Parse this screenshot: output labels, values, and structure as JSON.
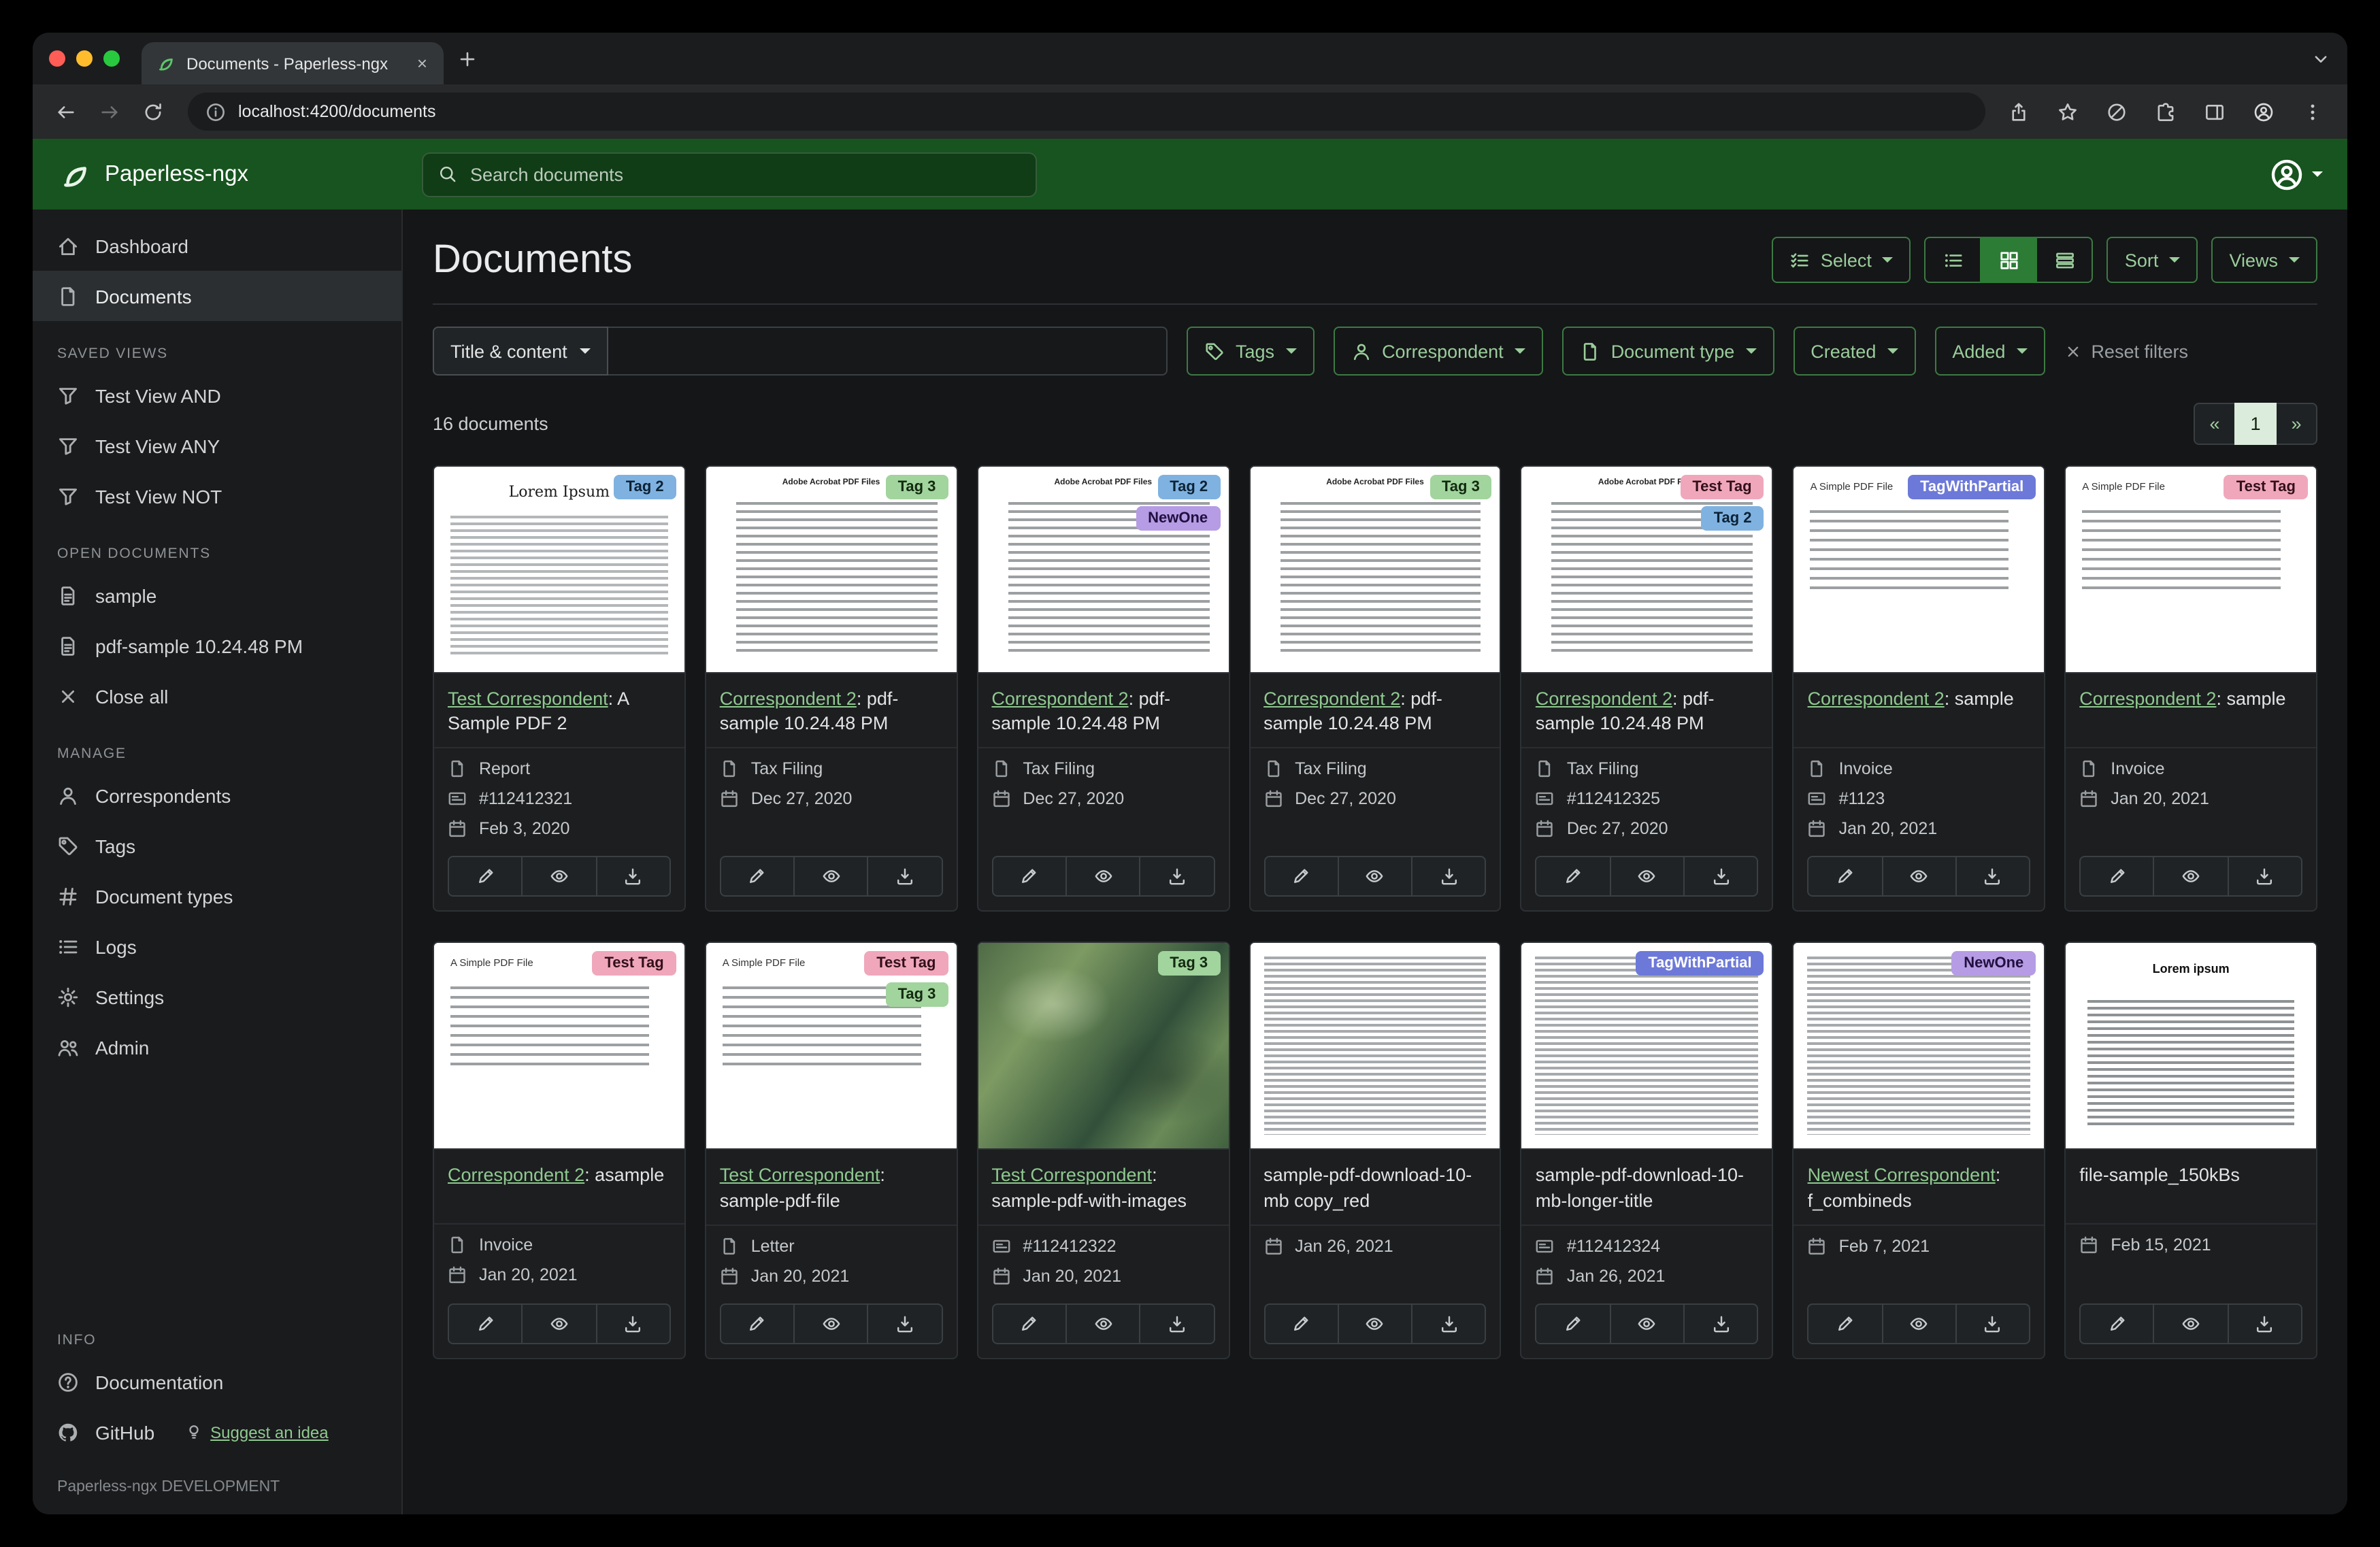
{
  "browser": {
    "tab_title": "Documents - Paperless-ngx",
    "url": "localhost:4200/documents"
  },
  "navbar": {
    "brand": "Paperless-ngx",
    "search_placeholder": "Search documents"
  },
  "sidebar": {
    "items": [
      {
        "label": "Dashboard",
        "icon": "house",
        "active": false
      },
      {
        "label": "Documents",
        "icon": "file",
        "active": true
      }
    ],
    "sections": [
      {
        "title": "SAVED VIEWS",
        "items": [
          {
            "label": "Test View AND",
            "icon": "funnel"
          },
          {
            "label": "Test View ANY",
            "icon": "funnel"
          },
          {
            "label": "Test View NOT",
            "icon": "funnel"
          }
        ]
      },
      {
        "title": "OPEN DOCUMENTS",
        "items": [
          {
            "label": "sample",
            "icon": "file-text"
          },
          {
            "label": "pdf-sample 10.24.48 PM",
            "icon": "file-text"
          },
          {
            "label": "Close all",
            "icon": "x"
          }
        ]
      },
      {
        "title": "MANAGE",
        "items": [
          {
            "label": "Correspondents",
            "icon": "person"
          },
          {
            "label": "Tags",
            "icon": "tag"
          },
          {
            "label": "Document types",
            "icon": "hash"
          },
          {
            "label": "Logs",
            "icon": "list"
          },
          {
            "label": "Settings",
            "icon": "gear"
          },
          {
            "label": "Admin",
            "icon": "people"
          }
        ]
      },
      {
        "title": "INFO",
        "items": [
          {
            "label": "Documentation",
            "icon": "question"
          },
          {
            "label": "GitHub",
            "icon": "github",
            "extra": {
              "label": "Suggest an idea",
              "icon": "bulb"
            }
          }
        ]
      }
    ],
    "footer": "Paperless-ngx DEVELOPMENT"
  },
  "main": {
    "title": "Documents",
    "toolbar": {
      "select_label": "Select",
      "sort_label": "Sort",
      "views_label": "Views",
      "view_modes": [
        {
          "icon": "list-ul",
          "active": false
        },
        {
          "icon": "grid",
          "active": true
        },
        {
          "icon": "hbars",
          "active": false
        }
      ]
    },
    "filters": {
      "field_label": "Title & content",
      "buttons": [
        {
          "label": "Tags",
          "icon": "tag"
        },
        {
          "label": "Correspondent",
          "icon": "person"
        },
        {
          "label": "Document type",
          "icon": "file"
        },
        {
          "label": "Created",
          "icon": null
        },
        {
          "label": "Added",
          "icon": null
        }
      ],
      "reset_label": "Reset filters"
    },
    "count": "16 documents",
    "pagination": [
      "«",
      "1",
      "»"
    ]
  },
  "tag_colors": {
    "Tag 2": {
      "bg": "#7fb2e0",
      "fg": "#0c2236"
    },
    "Tag 3": {
      "bg": "#a2d49d",
      "fg": "#122a10"
    },
    "NewOne": {
      "bg": "#b69ce4",
      "fg": "#221040"
    },
    "Test Tag": {
      "bg": "#f0a7bb",
      "fg": "#33101b"
    },
    "TagWithPartial": {
      "bg": "#6d79d8",
      "fg": "#ffffff"
    }
  },
  "documents": [
    {
      "thumb": "serif",
      "thumb_label": "Lorem Ipsum",
      "tags": [
        "Tag 2"
      ],
      "correspondent": "Test Correspondent",
      "title": ": A Sample PDF 2",
      "type": "Report",
      "asn": "#112412321",
      "date": "Feb 3, 2020"
    },
    {
      "thumb": "pdf",
      "thumb_label": "Adobe Acrobat PDF Files",
      "tags": [
        "Tag 3"
      ],
      "correspondent": "Correspondent 2",
      "title": ": pdf-sample 10.24.48 PM",
      "type": "Tax Filing",
      "date": "Dec 27, 2020"
    },
    {
      "thumb": "pdf",
      "thumb_label": "Adobe Acrobat PDF Files",
      "tags": [
        "Tag 2",
        "NewOne"
      ],
      "correspondent": "Correspondent 2",
      "title": ": pdf-sample 10.24.48 PM",
      "type": "Tax Filing",
      "date": "Dec 27, 2020"
    },
    {
      "thumb": "pdf",
      "thumb_label": "Adobe Acrobat PDF Files",
      "tags": [
        "Tag 3"
      ],
      "correspondent": "Correspondent 2",
      "title": ": pdf-sample 10.24.48 PM",
      "type": "Tax Filing",
      "date": "Dec 27, 2020"
    },
    {
      "thumb": "pdf",
      "thumb_label": "Adobe Acrobat PDF Files",
      "tags": [
        "Test Tag",
        "Tag 2"
      ],
      "correspondent": "Correspondent 2",
      "title": ": pdf-sample 10.24.48 PM",
      "type": "Tax Filing",
      "asn": "#112412325",
      "date": "Dec 27, 2020"
    },
    {
      "thumb": "simple",
      "thumb_label": "A Simple PDF File",
      "tags": [
        "TagWithPartial"
      ],
      "correspondent": "Correspondent 2",
      "title": ": sample",
      "type": "Invoice",
      "asn": "#1123",
      "date": "Jan 20, 2021"
    },
    {
      "thumb": "simple",
      "thumb_label": "A Simple PDF File",
      "tags": [
        "Test Tag"
      ],
      "correspondent": "Correspondent 2",
      "title": ": sample",
      "type": "Invoice",
      "date": "Jan 20, 2021"
    },
    {
      "thumb": "simple",
      "thumb_label": "A Simple PDF File",
      "tags": [
        "Test Tag"
      ],
      "correspondent": "Correspondent 2",
      "title": ": asample",
      "type": "Invoice",
      "date": "Jan 20, 2021"
    },
    {
      "thumb": "simple",
      "thumb_label": "A Simple PDF File",
      "tags": [
        "Test Tag",
        "Tag 3"
      ],
      "correspondent": "Test Correspondent",
      "title": ": sample-pdf-file",
      "type": "Letter",
      "date": "Jan 20, 2021"
    },
    {
      "thumb": "map",
      "tags": [
        "Tag 3"
      ],
      "correspondent": "Test Correspondent",
      "title": ": sample-pdf-with-images",
      "asn": "#112412322",
      "date": "Jan 20, 2021"
    },
    {
      "thumb": "dense",
      "tags": [],
      "title": "sample-pdf-download-10-mb copy_red",
      "date": "Jan 26, 2021"
    },
    {
      "thumb": "dense",
      "tags": [
        "TagWithPartial"
      ],
      "title": "sample-pdf-download-10-mb-longer-title",
      "asn": "#112412324",
      "date": "Jan 26, 2021"
    },
    {
      "thumb": "dense",
      "tags": [
        "NewOne"
      ],
      "correspondent": "Newest Correspondent",
      "title": ": f_combineds",
      "date": "Feb 7, 2021"
    },
    {
      "thumb": "lorem-center",
      "thumb_label": "Lorem ipsum",
      "tags": [],
      "title": "file-sample_150kBs",
      "date": "Feb 15, 2021"
    }
  ]
}
